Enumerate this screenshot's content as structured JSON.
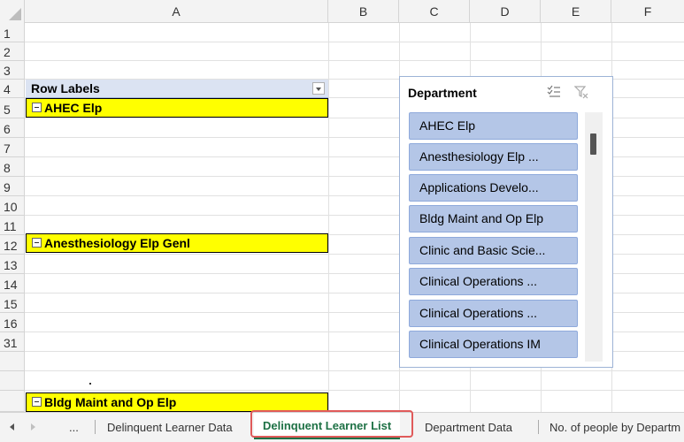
{
  "columns": [
    "A",
    "B",
    "C",
    "D",
    "E",
    "F"
  ],
  "rows": [
    "1",
    "2",
    "3",
    "4",
    "5",
    "6",
    "7",
    "8",
    "9",
    "10",
    "11",
    "12",
    "13",
    "14",
    "15",
    "16",
    "31"
  ],
  "pivot": {
    "header_label": "Row Labels",
    "groups": [
      "AHEC Elp",
      "Anesthesiology Elp Genl",
      "Bldg Maint and Op Elp"
    ]
  },
  "slicer": {
    "title": "Department",
    "items": [
      "AHEC Elp",
      "Anesthesiology Elp ...",
      "Applications Develo...",
      "Bldg Maint and Op Elp",
      "Clinic and Basic Scie...",
      "Clinical Operations ...",
      "Clinical Operations ...",
      "Clinical Operations IM"
    ],
    "item_color": "#b4c6e7"
  },
  "tabs": {
    "ellipsis": "...",
    "items": [
      "Delinquent Learner Data",
      "Delinquent Learner List",
      "Department Data",
      "No. of people by Departm"
    ],
    "active_index": 1,
    "active_color": "#1e7145"
  }
}
